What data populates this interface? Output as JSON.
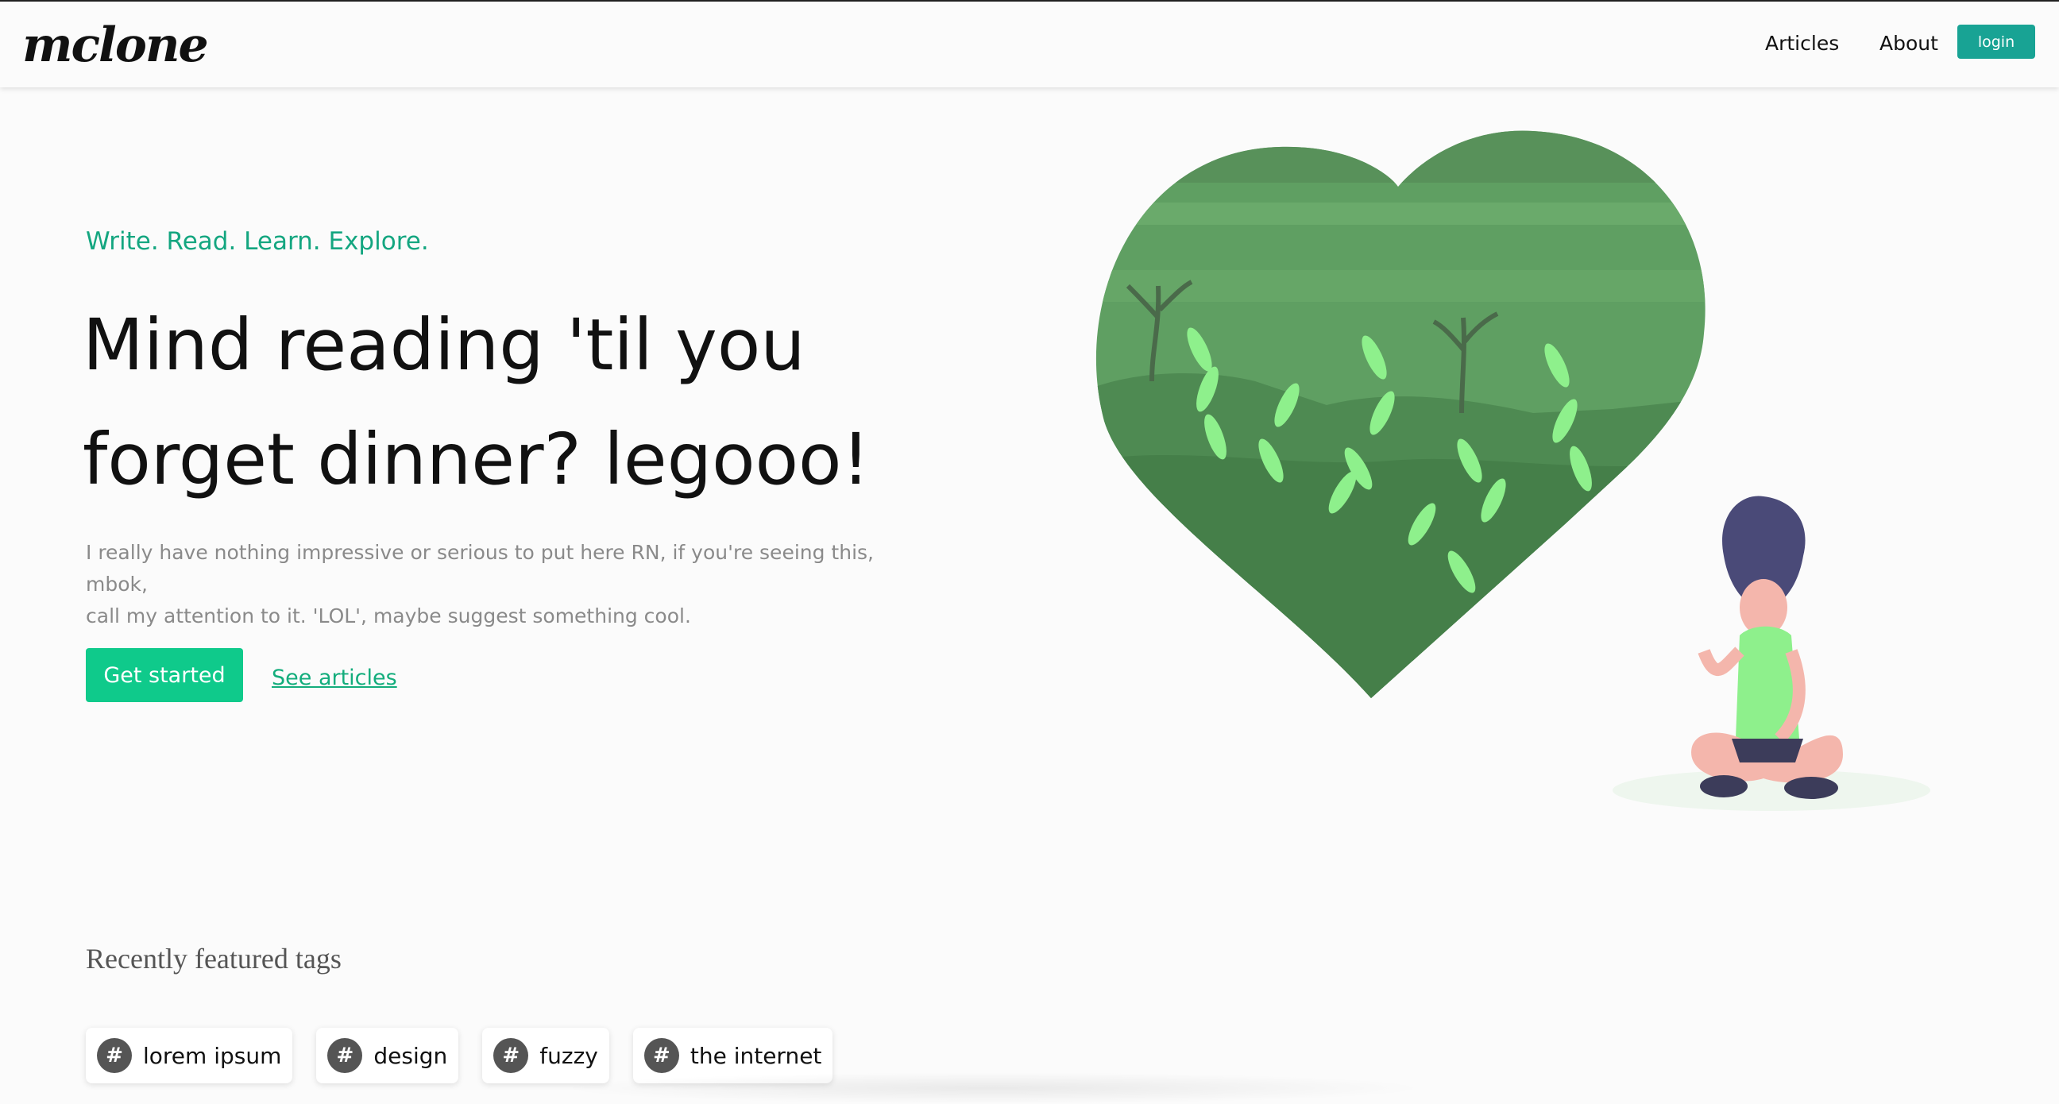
{
  "header": {
    "logo": "mclone",
    "nav": [
      {
        "label": "Articles"
      },
      {
        "label": "About"
      }
    ],
    "login_label": "login"
  },
  "hero": {
    "eyebrow": "Write. Read. Learn. Explore.",
    "headline_line1": "Mind reading 'til you",
    "headline_line2": "forget dinner? legooo!",
    "lede_line1": "I really have nothing impressive or serious to put here RN, if you're seeing this, mbok,",
    "lede_line2": "call my attention to it. 'LOL', maybe suggest something cool.",
    "cta_label": "Get started",
    "secondary_link": "See articles"
  },
  "tags": {
    "heading": "Recently featured tags",
    "hash_symbol": "#",
    "items": [
      "lorem ipsum",
      "design",
      "fuzzy",
      "the internet"
    ]
  },
  "colors": {
    "accent": "#0fca8b",
    "login": "#18a394",
    "eyebrow": "#14a680"
  }
}
